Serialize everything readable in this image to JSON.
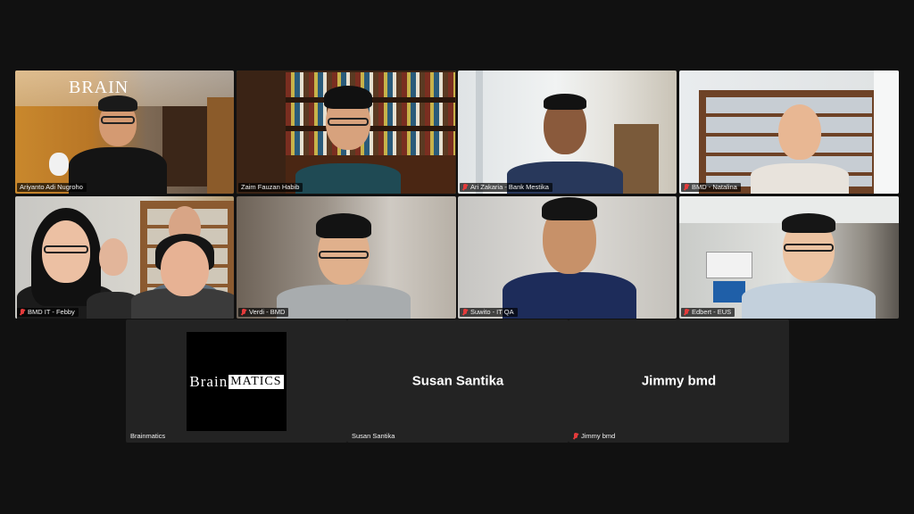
{
  "grid": {
    "tiles": [
      {
        "name": "Ariyanto Adi Nugroho",
        "muted": false
      },
      {
        "name": "Zaim Fauzan Habib",
        "muted": false,
        "active": true
      },
      {
        "name": "Ari Zakaria - Bank Mestika",
        "muted": true
      },
      {
        "name": "BMD - Natalina",
        "muted": true
      },
      {
        "name": "BMD IT - Febby",
        "muted": true
      },
      {
        "name": "Verdi - BMD",
        "muted": true
      },
      {
        "name": "Suwito - IT QA",
        "muted": true
      },
      {
        "name": "Edbert - EUS",
        "muted": true
      }
    ]
  },
  "audio_tiles": [
    {
      "name": "Brainmatics",
      "display": "",
      "muted": false,
      "logo": {
        "first": "Brain",
        "rest": "MATICS"
      }
    },
    {
      "name": "Susan Santika",
      "display": "Susan Santika",
      "muted": false
    },
    {
      "name": "Jimmy bmd",
      "display": "Jimmy bmd",
      "muted": true
    }
  ],
  "wall_sign": "BRAIN",
  "colors": {
    "background": "#111111",
    "active_speaker_border": "#29c76f",
    "muted_icon": "#e43b3b"
  }
}
